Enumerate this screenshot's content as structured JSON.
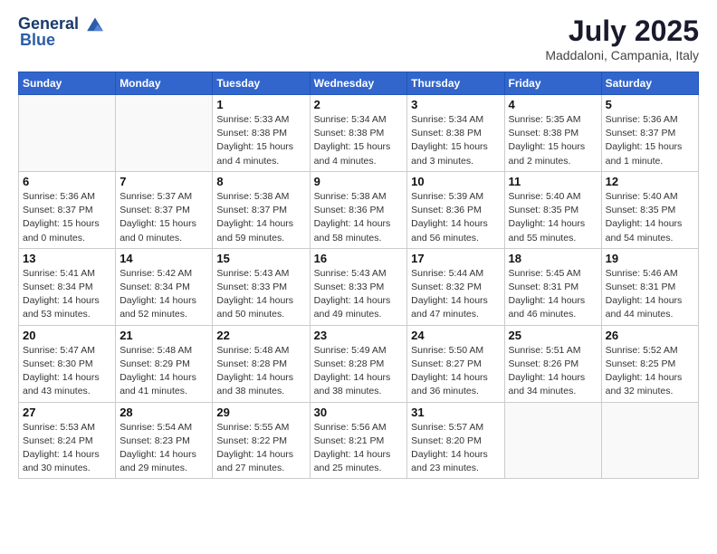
{
  "logo": {
    "line1": "General",
    "line2": "Blue"
  },
  "title": "July 2025",
  "subtitle": "Maddaloni, Campania, Italy",
  "weekdays": [
    "Sunday",
    "Monday",
    "Tuesday",
    "Wednesday",
    "Thursday",
    "Friday",
    "Saturday"
  ],
  "weeks": [
    [
      {
        "day": "",
        "info": ""
      },
      {
        "day": "",
        "info": ""
      },
      {
        "day": "1",
        "info": "Sunrise: 5:33 AM\nSunset: 8:38 PM\nDaylight: 15 hours and 4 minutes."
      },
      {
        "day": "2",
        "info": "Sunrise: 5:34 AM\nSunset: 8:38 PM\nDaylight: 15 hours and 4 minutes."
      },
      {
        "day": "3",
        "info": "Sunrise: 5:34 AM\nSunset: 8:38 PM\nDaylight: 15 hours and 3 minutes."
      },
      {
        "day": "4",
        "info": "Sunrise: 5:35 AM\nSunset: 8:38 PM\nDaylight: 15 hours and 2 minutes."
      },
      {
        "day": "5",
        "info": "Sunrise: 5:36 AM\nSunset: 8:37 PM\nDaylight: 15 hours and 1 minute."
      }
    ],
    [
      {
        "day": "6",
        "info": "Sunrise: 5:36 AM\nSunset: 8:37 PM\nDaylight: 15 hours and 0 minutes."
      },
      {
        "day": "7",
        "info": "Sunrise: 5:37 AM\nSunset: 8:37 PM\nDaylight: 15 hours and 0 minutes."
      },
      {
        "day": "8",
        "info": "Sunrise: 5:38 AM\nSunset: 8:37 PM\nDaylight: 14 hours and 59 minutes."
      },
      {
        "day": "9",
        "info": "Sunrise: 5:38 AM\nSunset: 8:36 PM\nDaylight: 14 hours and 58 minutes."
      },
      {
        "day": "10",
        "info": "Sunrise: 5:39 AM\nSunset: 8:36 PM\nDaylight: 14 hours and 56 minutes."
      },
      {
        "day": "11",
        "info": "Sunrise: 5:40 AM\nSunset: 8:35 PM\nDaylight: 14 hours and 55 minutes."
      },
      {
        "day": "12",
        "info": "Sunrise: 5:40 AM\nSunset: 8:35 PM\nDaylight: 14 hours and 54 minutes."
      }
    ],
    [
      {
        "day": "13",
        "info": "Sunrise: 5:41 AM\nSunset: 8:34 PM\nDaylight: 14 hours and 53 minutes."
      },
      {
        "day": "14",
        "info": "Sunrise: 5:42 AM\nSunset: 8:34 PM\nDaylight: 14 hours and 52 minutes."
      },
      {
        "day": "15",
        "info": "Sunrise: 5:43 AM\nSunset: 8:33 PM\nDaylight: 14 hours and 50 minutes."
      },
      {
        "day": "16",
        "info": "Sunrise: 5:43 AM\nSunset: 8:33 PM\nDaylight: 14 hours and 49 minutes."
      },
      {
        "day": "17",
        "info": "Sunrise: 5:44 AM\nSunset: 8:32 PM\nDaylight: 14 hours and 47 minutes."
      },
      {
        "day": "18",
        "info": "Sunrise: 5:45 AM\nSunset: 8:31 PM\nDaylight: 14 hours and 46 minutes."
      },
      {
        "day": "19",
        "info": "Sunrise: 5:46 AM\nSunset: 8:31 PM\nDaylight: 14 hours and 44 minutes."
      }
    ],
    [
      {
        "day": "20",
        "info": "Sunrise: 5:47 AM\nSunset: 8:30 PM\nDaylight: 14 hours and 43 minutes."
      },
      {
        "day": "21",
        "info": "Sunrise: 5:48 AM\nSunset: 8:29 PM\nDaylight: 14 hours and 41 minutes."
      },
      {
        "day": "22",
        "info": "Sunrise: 5:48 AM\nSunset: 8:28 PM\nDaylight: 14 hours and 38 minutes."
      },
      {
        "day": "23",
        "info": "Sunrise: 5:49 AM\nSunset: 8:28 PM\nDaylight: 14 hours and 38 minutes."
      },
      {
        "day": "24",
        "info": "Sunrise: 5:50 AM\nSunset: 8:27 PM\nDaylight: 14 hours and 36 minutes."
      },
      {
        "day": "25",
        "info": "Sunrise: 5:51 AM\nSunset: 8:26 PM\nDaylight: 14 hours and 34 minutes."
      },
      {
        "day": "26",
        "info": "Sunrise: 5:52 AM\nSunset: 8:25 PM\nDaylight: 14 hours and 32 minutes."
      }
    ],
    [
      {
        "day": "27",
        "info": "Sunrise: 5:53 AM\nSunset: 8:24 PM\nDaylight: 14 hours and 30 minutes."
      },
      {
        "day": "28",
        "info": "Sunrise: 5:54 AM\nSunset: 8:23 PM\nDaylight: 14 hours and 29 minutes."
      },
      {
        "day": "29",
        "info": "Sunrise: 5:55 AM\nSunset: 8:22 PM\nDaylight: 14 hours and 27 minutes."
      },
      {
        "day": "30",
        "info": "Sunrise: 5:56 AM\nSunset: 8:21 PM\nDaylight: 14 hours and 25 minutes."
      },
      {
        "day": "31",
        "info": "Sunrise: 5:57 AM\nSunset: 8:20 PM\nDaylight: 14 hours and 23 minutes."
      },
      {
        "day": "",
        "info": ""
      },
      {
        "day": "",
        "info": ""
      }
    ]
  ]
}
